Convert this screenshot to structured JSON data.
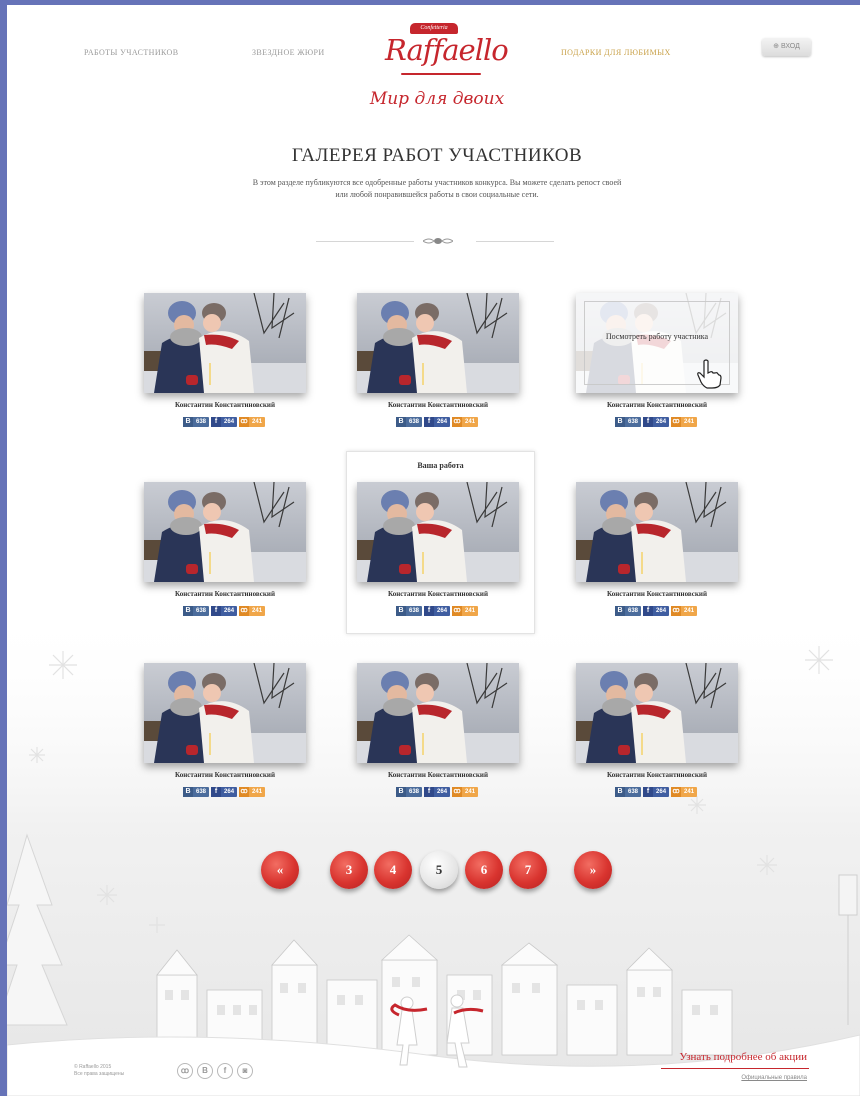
{
  "header": {
    "nav_participants": "РАБОТЫ УЧАСТНИКОВ",
    "nav_jury": "ЗВЕЗДНОЕ ЖЮРИ",
    "logo_badge": "Confetteria",
    "logo_text": "Raffaello",
    "nav_gifts": "ПОДАРКИ ДЛЯ ЛЮБИМЫХ",
    "login_label": "ВХОД",
    "tagline": "Мир для двоих",
    "accent_color": "#c6262d",
    "gold_color": "#c9a24a"
  },
  "gallery": {
    "title": "ГАЛЕРЕЯ РАБОТ УЧАСТНИКОВ",
    "description": "В этом разделе публикуются все одобренные работы участников конкурса. Вы можете сделать репост своей или любой понравившейся работы в свои социальные сети.",
    "hover_text": "Посмотреть работу участника",
    "your_work_label": "Ваша работа",
    "cards": [
      {
        "name": "Константин Константиновский",
        "vk": "638",
        "fb": "264",
        "ok": "241"
      },
      {
        "name": "Константин Константиновский",
        "vk": "638",
        "fb": "264",
        "ok": "241"
      },
      {
        "name": "Константин Константиновский",
        "vk": "638",
        "fb": "264",
        "ok": "241"
      },
      {
        "name": "Константин Константиновский",
        "vk": "638",
        "fb": "264",
        "ok": "241"
      },
      {
        "name": "Константин Константиновский",
        "vk": "638",
        "fb": "264",
        "ok": "241"
      },
      {
        "name": "Константин Константиновский",
        "vk": "638",
        "fb": "264",
        "ok": "241"
      },
      {
        "name": "Константин Константиновский",
        "vk": "638",
        "fb": "264",
        "ok": "241"
      },
      {
        "name": "Константин Константиновский",
        "vk": "638",
        "fb": "264",
        "ok": "241"
      },
      {
        "name": "Константин Константиновский",
        "vk": "638",
        "fb": "264",
        "ok": "241"
      }
    ]
  },
  "pagination": {
    "prev": "«",
    "next": "»",
    "pages": [
      "3",
      "4",
      "5",
      "6",
      "7"
    ],
    "current": "5"
  },
  "footer": {
    "copyright_1": "© Raffaello 2015",
    "copyright_2": "Все права защищены",
    "learn_more": "Узнать подробнее об акции",
    "rules": "Официальные правила",
    "social": [
      "ok-icon",
      "vk-icon",
      "facebook-icon",
      "instagram-icon"
    ]
  }
}
